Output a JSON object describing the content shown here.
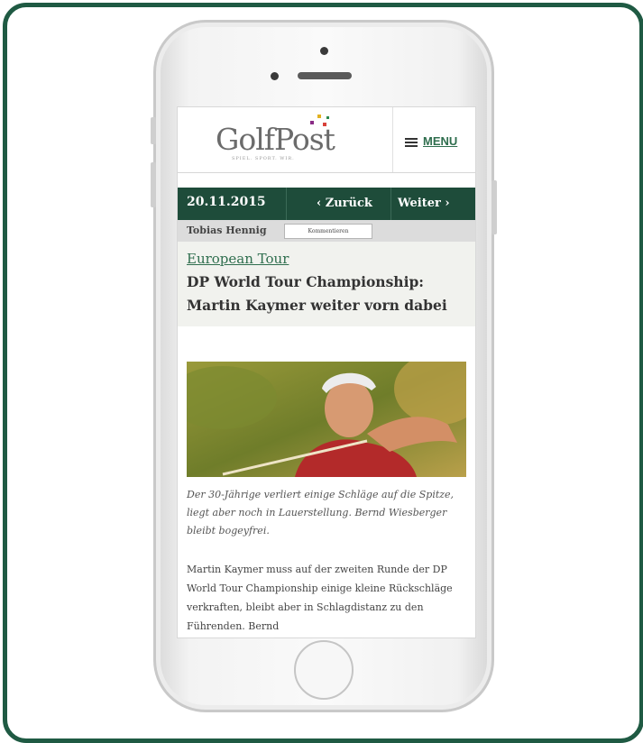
{
  "header": {
    "logo_text": "GolfPost",
    "logo_tagline": "SPIEL. SPORT. WIR.",
    "menu_label": "MENU"
  },
  "nav": {
    "date": "20.11.2015",
    "prev_label": "‹ Zurück",
    "next_label": "Weiter ›"
  },
  "author_bar": {
    "author": "Tobias Hennig",
    "comment_button": "Kommentieren"
  },
  "article": {
    "category": "European Tour",
    "title": "DP World Tour Championship: Martin Kaymer weiter vorn dabei",
    "caption": "Der 30-Jährige verliert einige Schläge auf die Spitze, liegt aber noch in Lauerstellung. Bernd Wiesberger bleibt bogeyfrei.",
    "body": "Martin Kaymer muss auf der zweiten Runde der DP World Tour Championship einige kleine Rückschläge verkraften, bleibt aber in Schlagdistanz zu den Führenden. Bernd"
  },
  "colors": {
    "frame_green": "#1f5a43",
    "nav_green": "#1e4c3a",
    "link_green": "#2f6e4e"
  }
}
